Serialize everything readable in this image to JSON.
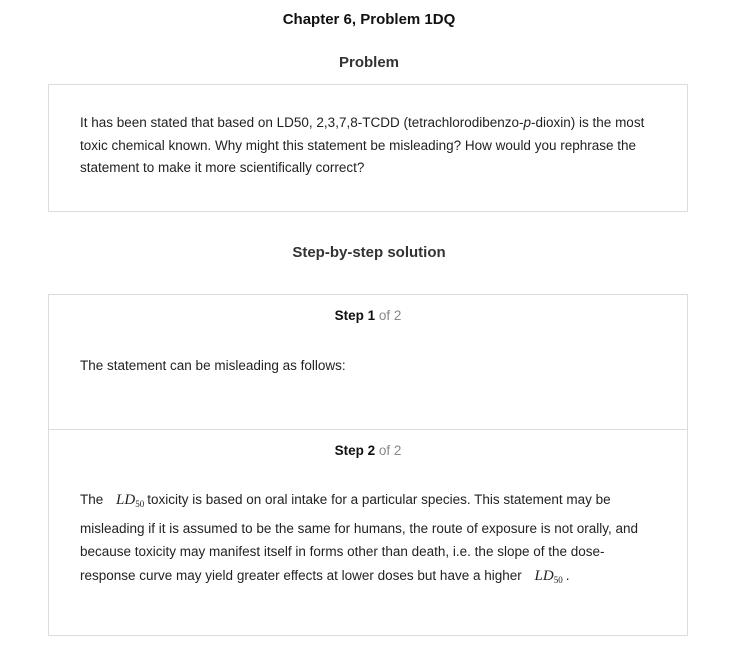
{
  "header": {
    "title": "Chapter 6, Problem 1DQ"
  },
  "problem": {
    "heading": "Problem",
    "text_before_italic": "It has been stated that based on LD50, 2,3,7,8-TCDD (tetrachlorodibenzo-",
    "italic": "p",
    "text_after_italic": "-dioxin) is the most toxic chemical known. Why might this statement be misleading? How would you rephrase the statement to make it more scientifically correct?"
  },
  "solution": {
    "heading": "Step-by-step solution",
    "steps": [
      {
        "step_word": "Step",
        "number": "1",
        "of_total": "of 2",
        "text": "The statement can be misleading as follows:"
      },
      {
        "step_word": "Step",
        "number": "2",
        "of_total": "of 2",
        "text_start": "The",
        "math_main": "LD",
        "math_sub": "50",
        "text_middle": "toxicity is based on oral intake for a particular species. This statement may be misleading if it is assumed to be the same for humans, the route of exposure is not orally, and because toxicity may manifest itself in forms other than death, i.e. the slope of the dose-response curve may yield greater effects at lower doses but have a higher",
        "text_end": "."
      }
    ]
  }
}
